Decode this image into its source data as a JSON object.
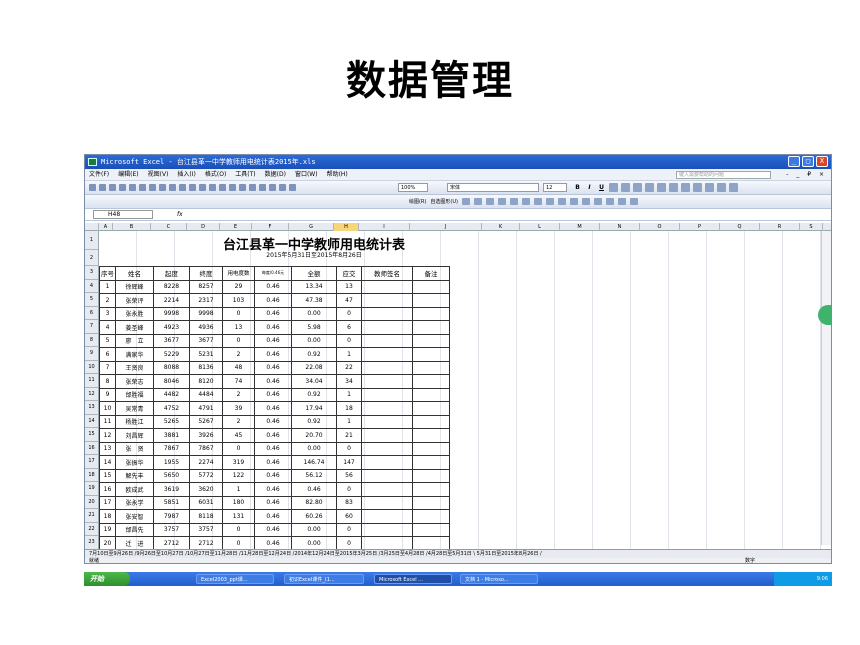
{
  "slide_title": "数据管理",
  "window": {
    "title": "Microsoft Excel - 台江县革一中学教师用电统计表2015年.xls",
    "btn_min": "_",
    "btn_max": "□",
    "btn_close": "X"
  },
  "menu": {
    "items": [
      "文件(F)",
      "编辑(E)",
      "视图(V)",
      "插入(I)",
      "格式(O)",
      "工具(T)",
      "数据(D)",
      "窗口(W)",
      "帮助(H)"
    ],
    "help_placeholder": "键入需要帮助的问题",
    "mdi": "- _ ₽ ×"
  },
  "toolbar": {
    "zoom": "100%",
    "font": "宋体",
    "size": "12",
    "bold": "B",
    "italic": "I",
    "underline": "U",
    "draw": "绘图(R)",
    "autoshape": "自选图形(U)"
  },
  "formula_bar": {
    "cell_ref": "H48",
    "fx": "fx"
  },
  "columns": [
    "A",
    "B",
    "C",
    "D",
    "E",
    "F",
    "G",
    "H",
    "I",
    "J",
    "K",
    "L",
    "M",
    "N",
    "O",
    "P",
    "Q",
    "R",
    "S"
  ],
  "rows": [
    "1",
    "2",
    "3",
    "4",
    "5",
    "6",
    "7",
    "8",
    "9",
    "10",
    "11",
    "12",
    "13",
    "14",
    "15",
    "16",
    "17",
    "18",
    "19",
    "20",
    "21",
    "22",
    "23"
  ],
  "sheet": {
    "title": "台江县革一中学教师用电统计表",
    "subtitle": "2015年5月31日至2015年8月26日",
    "headers": [
      "序号",
      "姓名",
      "起度",
      "终度",
      "用电度数",
      "每度/0.46元",
      "全额",
      "应交",
      "教师签名",
      "备注"
    ],
    "data": [
      [
        "1",
        "徐辉峰",
        "8228",
        "8257",
        "29",
        "0.46",
        "13.34",
        "13"
      ],
      [
        "2",
        "张荣评",
        "2214",
        "2317",
        "103",
        "0.46",
        "47.38",
        "47"
      ],
      [
        "3",
        "张永胜",
        "9998",
        "9998",
        "0",
        "0.46",
        "0.00",
        "0"
      ],
      [
        "4",
        "姜圣峰",
        "4923",
        "4936",
        "13",
        "0.46",
        "5.98",
        "6"
      ],
      [
        "5",
        "廖　立",
        "3677",
        "3677",
        "0",
        "0.46",
        "0.00",
        "0"
      ],
      [
        "6",
        "满家华",
        "5229",
        "5231",
        "2",
        "0.46",
        "0.92",
        "1"
      ],
      [
        "7",
        "王贤良",
        "8088",
        "8136",
        "48",
        "0.46",
        "22.08",
        "22"
      ],
      [
        "8",
        "张荣志",
        "8046",
        "8120",
        "74",
        "0.46",
        "34.04",
        "34"
      ],
      [
        "9",
        "邰胜福",
        "4482",
        "4484",
        "2",
        "0.46",
        "0.92",
        "1"
      ],
      [
        "10",
        "吴常青",
        "4752",
        "4791",
        "39",
        "0.46",
        "17.94",
        "18"
      ],
      [
        "11",
        "杨胜江",
        "5265",
        "5267",
        "2",
        "0.46",
        "0.92",
        "1"
      ],
      [
        "12",
        "刘昌辉",
        "3881",
        "3926",
        "45",
        "0.46",
        "20.70",
        "21"
      ],
      [
        "13",
        "张　贤",
        "7867",
        "7867",
        "0",
        "0.46",
        "0.00",
        "0"
      ],
      [
        "14",
        "张振华",
        "1955",
        "2274",
        "319",
        "0.46",
        "146.74",
        "147"
      ],
      [
        "15",
        "解先丰",
        "5650",
        "5772",
        "122",
        "0.46",
        "56.12",
        "56"
      ],
      [
        "16",
        "欧成武",
        "3619",
        "3620",
        "1",
        "0.46",
        "0.46",
        "0"
      ],
      [
        "17",
        "张永学",
        "5851",
        "6031",
        "180",
        "0.46",
        "82.80",
        "83"
      ],
      [
        "18",
        "张安智",
        "7987",
        "8118",
        "131",
        "0.46",
        "60.26",
        "60"
      ],
      [
        "19",
        "邰昌先",
        "3757",
        "3757",
        "0",
        "0.46",
        "0.00",
        "0"
      ],
      [
        "20",
        "迁　进",
        "2712",
        "2712",
        "0",
        "0.46",
        "0.00",
        "0"
      ]
    ]
  },
  "sheet_tabs": "7月10日至9月26日 /9月26日至10月27日 /10月27日至11月28日 /11月28日至12月24日 /2014年12月24日至2015年3月25日 /3月25日至4月28日 /4月28日至5月31日 \\ 5月31日至2015年8月26日 /",
  "status": {
    "left": "就绪",
    "right": "数字"
  },
  "taskbar": {
    "start": "开始",
    "tasks": [
      "Excel2003_ppt课...",
      "初识Excel课件_(1...",
      "Microsoft Excel ...",
      "文档 1 - Microso..."
    ],
    "clock": "9:06"
  }
}
